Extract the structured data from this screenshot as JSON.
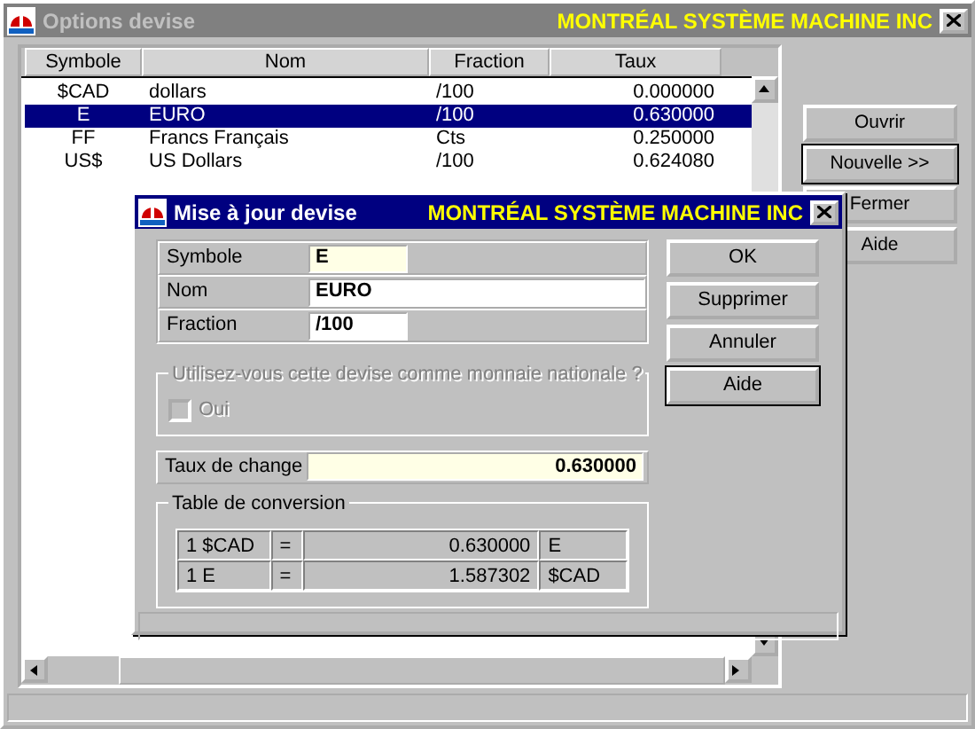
{
  "window": {
    "title": "Options devise",
    "brand": "MONTRÉAL SYSTÈME MACHINE INC",
    "active": false
  },
  "table": {
    "columns": [
      "Symbole",
      "Nom",
      "Fraction",
      "Taux"
    ],
    "rows": [
      {
        "cells": [
          "$CAD",
          "dollars",
          "/100",
          "0.000000"
        ],
        "selected": false
      },
      {
        "cells": [
          "E",
          "EURO",
          "/100",
          "0.630000"
        ],
        "selected": true
      },
      {
        "cells": [
          "FF",
          "Francs Français",
          "Cts",
          "0.250000"
        ],
        "selected": false
      },
      {
        "cells": [
          "US$",
          "US Dollars",
          "/100",
          "0.624080"
        ],
        "selected": false
      }
    ]
  },
  "buttons": [
    {
      "label": "Ouvrir",
      "default": false
    },
    {
      "label": "Nouvelle >>",
      "default": true
    },
    {
      "label": "Fermer",
      "default": false
    },
    {
      "label": "Aide",
      "default": false
    }
  ],
  "dialog": {
    "title": "Mise à jour devise",
    "brand": "MONTRÉAL SYSTÈME MACHINE INC",
    "active": true,
    "fields": [
      {
        "label": "Symbole",
        "value": "E",
        "highlighted": true
      },
      {
        "label": "Nom",
        "value": "EURO",
        "highlighted": false
      },
      {
        "label": "Fraction",
        "value": "/100",
        "highlighted": false
      }
    ],
    "national": {
      "legend": "Utilisez-vous cette devise comme monnaie nationale ?",
      "option": "Oui",
      "checked": false,
      "disabled": true
    },
    "rate": {
      "label": "Taux de change",
      "value": "0.630000"
    },
    "conversion": {
      "legend": "Table de conversion",
      "rows": [
        [
          "1 $CAD",
          "=",
          "0.630000",
          "E"
        ],
        [
          "1 E",
          "=",
          "1.587302",
          "$CAD"
        ]
      ]
    },
    "buttons": [
      {
        "label": "OK",
        "default": false
      },
      {
        "label": "Supprimer",
        "default": false
      },
      {
        "label": "Annuler",
        "default": false
      },
      {
        "label": "Aide",
        "default": true
      }
    ]
  }
}
